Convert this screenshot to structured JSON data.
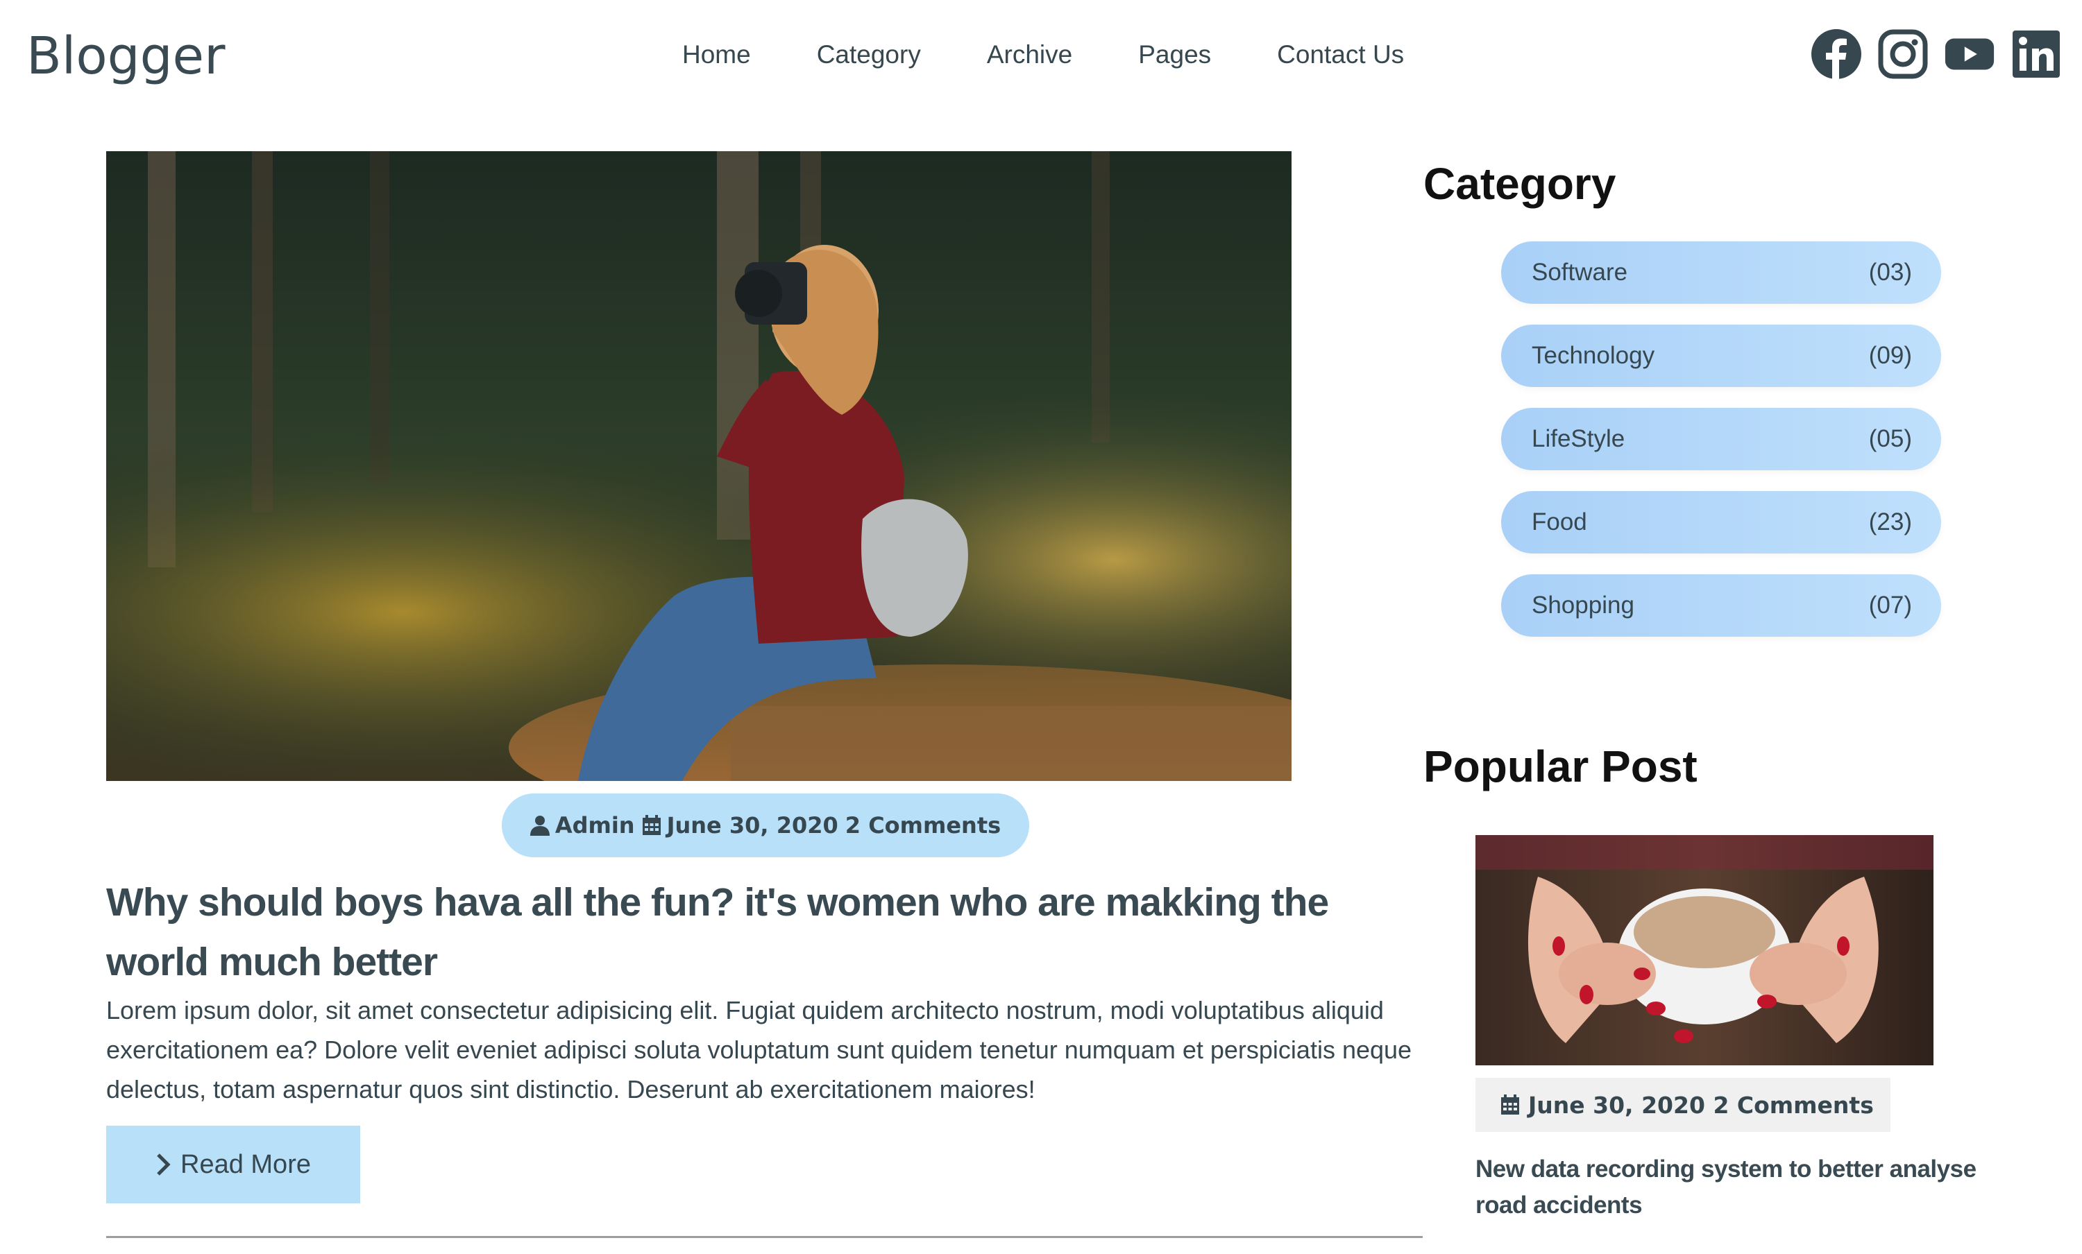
{
  "header": {
    "logo": "Blogger",
    "nav": [
      "Home",
      "Category",
      "Archive",
      "Pages",
      "Contact Us"
    ],
    "social_icons": [
      "facebook-icon",
      "instagram-icon",
      "youtube-icon",
      "linkedin-icon"
    ]
  },
  "post": {
    "author": "Admin",
    "date": "June 30, 2020",
    "comments": "2 Comments",
    "title": "Why should boys hava all the fun? it's women who are makking the world much better",
    "excerpt": "Lorem ipsum dolor, sit amet consectetur adipisicing elit. Fugiat quidem architecto nostrum, modi voluptatibus aliquid exercitationem ea? Dolore velit eveniet adipisci soluta voluptatum sunt quidem tenetur numquam et perspiciatis neque delectus, totam aspernatur quos sint distinctio. Deserunt ab exercitationem maiores!",
    "read_more": "Read More"
  },
  "sidebar": {
    "category_heading": "Category",
    "categories": [
      {
        "name": "Software",
        "count": "(03)"
      },
      {
        "name": "Technology",
        "count": "(09)"
      },
      {
        "name": "LifeStyle",
        "count": "(05)"
      },
      {
        "name": "Food",
        "count": "(23)"
      },
      {
        "name": "Shopping",
        "count": "(07)"
      }
    ],
    "popular_heading": "Popular Post",
    "popular": {
      "date": "June 30, 2020",
      "comments": "2 Comments",
      "title": "New data recording system to better analyse road accidents"
    }
  },
  "colors": {
    "accent_light_blue": "#b8e0f8",
    "category_pill": "#a9d0f7",
    "text": "#37474f"
  }
}
